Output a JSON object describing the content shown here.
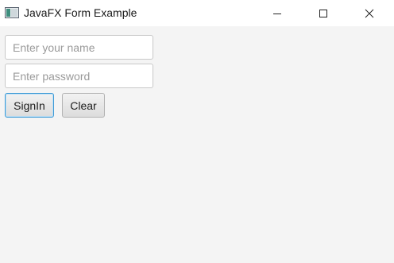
{
  "window": {
    "title": "JavaFX Form Example",
    "controls": {
      "minimize_icon": "minimize-icon",
      "maximize_icon": "maximize-icon",
      "close_icon": "close-icon"
    }
  },
  "form": {
    "name_field": {
      "value": "",
      "placeholder": "Enter your name"
    },
    "password_field": {
      "value": "",
      "placeholder": "Enter password"
    },
    "signin_label": "SignIn",
    "clear_label": "Clear"
  },
  "colors": {
    "background": "#f4f4f4",
    "titlebar": "#ffffff",
    "focus_border": "#3c9ad6"
  }
}
